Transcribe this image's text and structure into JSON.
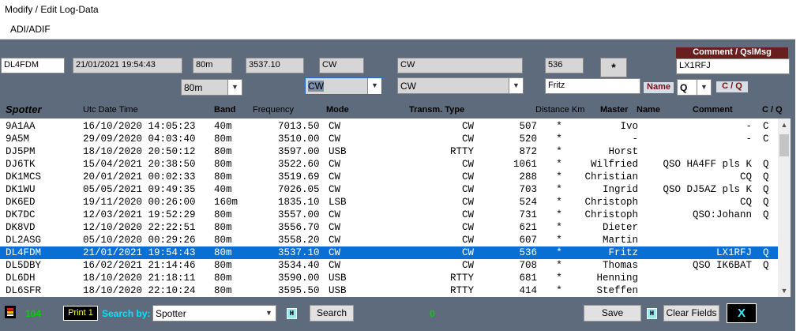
{
  "window": {
    "title": "Modify / Edit Log-Data"
  },
  "menu": {
    "adi": "ADI/ADIF"
  },
  "edit": {
    "spotter": "DL4FDM",
    "datetime": "21/01/2021 19:54:43",
    "band": "80m",
    "frequency": "3537.10",
    "mode": "CW",
    "transm_type": "CW",
    "distance": "536",
    "master": "*",
    "comment": "LX1RFJ",
    "band_select": "80m",
    "mode_select": "CW",
    "transm_select": "CW",
    "name": "Fritz",
    "cq_select": "Q",
    "comment_label": "Comment / QslMsg",
    "name_label": "Name",
    "cq_label": "C / Q"
  },
  "columns": {
    "spotter": "Spotter",
    "utc": "Utc Date Time",
    "band": "Band",
    "frequency": "Frequency",
    "mode": "Mode",
    "transm": "Transm. Type",
    "distance": "Distance Km",
    "master": "Master",
    "name": "Name",
    "comment": "Comment",
    "cq": "C / Q"
  },
  "rows": [
    {
      "spotter": "9A1AA",
      "dt": "16/10/2020 14:05:23",
      "band": "40m",
      "freq": "7013.50",
      "mode": "CW",
      "transm": "CW",
      "dist": "507",
      "master": "*",
      "name": "Ivo",
      "comment": "-",
      "cq": "C"
    },
    {
      "spotter": "9A5M",
      "dt": "29/09/2020 04:03:40",
      "band": "80m",
      "freq": "3510.00",
      "mode": "CW",
      "transm": "CW",
      "dist": "520",
      "master": "*",
      "name": "-",
      "comment": "-",
      "cq": "C"
    },
    {
      "spotter": "DJ5PM",
      "dt": "18/10/2020 20:50:12",
      "band": "80m",
      "freq": "3597.00",
      "mode": "USB",
      "transm": "RTTY",
      "dist": "872",
      "master": "*",
      "name": "Horst",
      "comment": "",
      "cq": ""
    },
    {
      "spotter": "DJ6TK",
      "dt": "15/04/2021 20:38:50",
      "band": "80m",
      "freq": "3522.60",
      "mode": "CW",
      "transm": "CW",
      "dist": "1061",
      "master": "*",
      "name": "Wilfried",
      "comment": "QSO HA4FF pls K",
      "cq": "Q"
    },
    {
      "spotter": "DK1MCS",
      "dt": "20/01/2021 00:02:33",
      "band": "80m",
      "freq": "3519.69",
      "mode": "CW",
      "transm": "CW",
      "dist": "288",
      "master": "*",
      "name": "Christian",
      "comment": "CQ",
      "cq": "Q"
    },
    {
      "spotter": "DK1WU",
      "dt": "05/05/2021 09:49:35",
      "band": "40m",
      "freq": "7026.05",
      "mode": "CW",
      "transm": "CW",
      "dist": "703",
      "master": "*",
      "name": "Ingrid",
      "comment": "QSO DJ5AZ pls K",
      "cq": "Q"
    },
    {
      "spotter": "DK6ED",
      "dt": "19/11/2020 00:26:00",
      "band": "160m",
      "freq": "1835.10",
      "mode": "LSB",
      "transm": "CW",
      "dist": "524",
      "master": "*",
      "name": "Christoph",
      "comment": "CQ",
      "cq": "Q"
    },
    {
      "spotter": "DK7DC",
      "dt": "12/03/2021 19:52:29",
      "band": "80m",
      "freq": "3557.00",
      "mode": "CW",
      "transm": "CW",
      "dist": "731",
      "master": "*",
      "name": "Christoph",
      "comment": "QSO:Johann",
      "cq": "Q"
    },
    {
      "spotter": "DK8VD",
      "dt": "12/10/2020 22:22:51",
      "band": "80m",
      "freq": "3556.70",
      "mode": "CW",
      "transm": "CW",
      "dist": "621",
      "master": "*",
      "name": "Dieter",
      "comment": "",
      "cq": ""
    },
    {
      "spotter": "DL2ASG",
      "dt": "05/10/2020 00:29:26",
      "band": "80m",
      "freq": "3558.20",
      "mode": "CW",
      "transm": "CW",
      "dist": "607",
      "master": "*",
      "name": "Martin",
      "comment": "",
      "cq": ""
    },
    {
      "spotter": "DL4FDM",
      "dt": "21/01/2021 19:54:43",
      "band": "80m",
      "freq": "3537.10",
      "mode": "CW",
      "transm": "CW",
      "dist": "536",
      "master": "*",
      "name": "Fritz",
      "comment": "LX1RFJ",
      "cq": "Q"
    },
    {
      "spotter": "DL5DBY",
      "dt": "16/02/2021 21:14:46",
      "band": "80m",
      "freq": "3534.40",
      "mode": "CW",
      "transm": "CW",
      "dist": "708",
      "master": "*",
      "name": "Thomas",
      "comment": "QSO IK6BAT",
      "cq": "Q"
    },
    {
      "spotter": "DL6DH",
      "dt": "18/10/2020 21:18:11",
      "band": "80m",
      "freq": "3590.00",
      "mode": "USB",
      "transm": "RTTY",
      "dist": "681",
      "master": "*",
      "name": "Henning",
      "comment": "",
      "cq": ""
    },
    {
      "spotter": "DL6SFR",
      "dt": "18/10/2020 22:10:24",
      "band": "80m",
      "freq": "3595.50",
      "mode": "USB",
      "transm": "RTTY",
      "dist": "414",
      "master": "*",
      "name": "Steffen",
      "comment": "",
      "cq": ""
    }
  ],
  "footer": {
    "count": "104",
    "print": "Print 1",
    "search_by_label": "Search by:",
    "search_by_value": "Spotter",
    "h_label": "H",
    "search_button": "Search",
    "found": "0",
    "save_button": "Save",
    "clear_button": "Clear Fields",
    "close_button": "X"
  },
  "colors": {
    "background": "#5e6b7c",
    "selected_row": "#0a6fd4",
    "green_text": "#00d000",
    "search_label": "#00e5ff"
  }
}
